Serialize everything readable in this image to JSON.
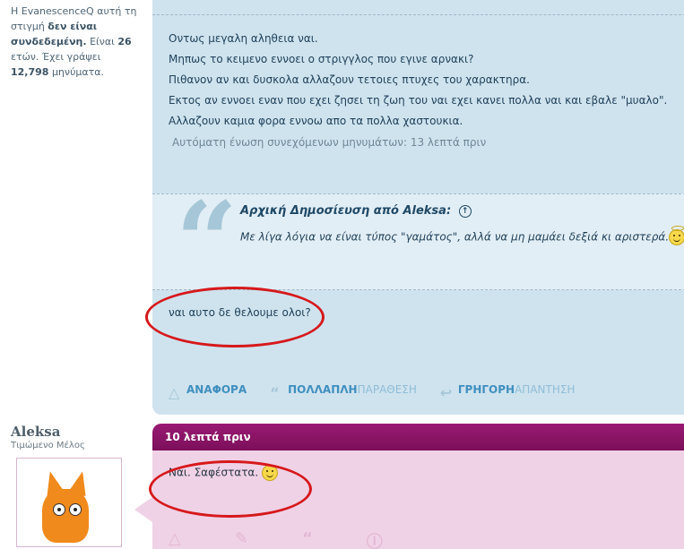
{
  "user_status": {
    "prefix": "Η EvanescenceQ αυτή τη στιγμή ",
    "status": "δεν είναι συνδεδεμένη.",
    "age_prefix": " Είναι ",
    "age": "26",
    "age_suffix": " ετών. Έχει γράψει ",
    "posts": "12,798",
    "posts_suffix": " μηνύματα."
  },
  "post1": {
    "lines": [
      "Οντως μεγαλη αληθεια ναι.",
      "Μηπως το κειμενο εννοει ο στριγγλος που εγινε αρνακι?",
      "Πιθανον αν και δυσκολα αλλαζουν τετοιες πτυχες του χαρακτηρα.",
      "Εκτος αν εννοει εναν που εχει ζησει τη ζωη του ναι εχει κανει πολλα ναι και εβαλε \"μυαλο\".",
      "Αλλαζουν καμια φορα εννοω απο τα πολλα χαστουκια."
    ],
    "merge_note": "Αυτόματη ένωση συνεχόμενων μηνυμάτων: 13 λεπτά πριν",
    "quote": {
      "header_prefix": "Αρχική Δημοσίευση από ",
      "author": "Aleksa",
      "text": "Με λίγα λόγια να είναι τύπος \"γαμάτος\", αλλά να μη μαμάει δεξιά κι αριστερά."
    },
    "reply": "ναι αυτο δε θελουμε ολοι?",
    "actions": {
      "quote_label": "ΑΝΑΦΟΡΑ",
      "multi_bold": "ΠΟΛΛΑΠΛΗ",
      "multi_light": "ΠΑΡΑΘΕΣΗ",
      "quick_bold": "ΓΡΗΓΟΡΗ",
      "quick_light": "ΑΠΑΝΤΗΣΗ"
    }
  },
  "post2": {
    "author": "Aleksa",
    "rank": "Τιμώμενο Μέλος",
    "time": "10 λεπτά πριν",
    "text": "Ναι. Σαφέστατα."
  },
  "colors": {
    "post1_bg": "#cfe3ee",
    "post2_header": "#8a1465",
    "post2_bg": "#f0d2e6",
    "annotation": "#d6191c"
  }
}
